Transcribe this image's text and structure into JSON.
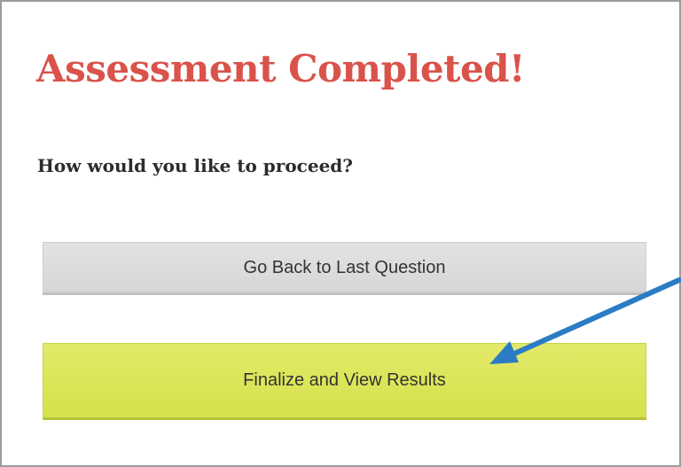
{
  "dialog": {
    "title": "Assessment Completed!",
    "prompt": "How would you like to proceed?"
  },
  "actions": {
    "back_label": "Go Back to Last Question",
    "finalize_label": "Finalize and View Results"
  },
  "colors": {
    "title": "#d9534a",
    "back_button": "#dadada",
    "finalize_button": "#dde65a",
    "annotation_arrow": "#2b7cc4"
  },
  "icons": {
    "annotation": "arrow-pointer-icon"
  }
}
